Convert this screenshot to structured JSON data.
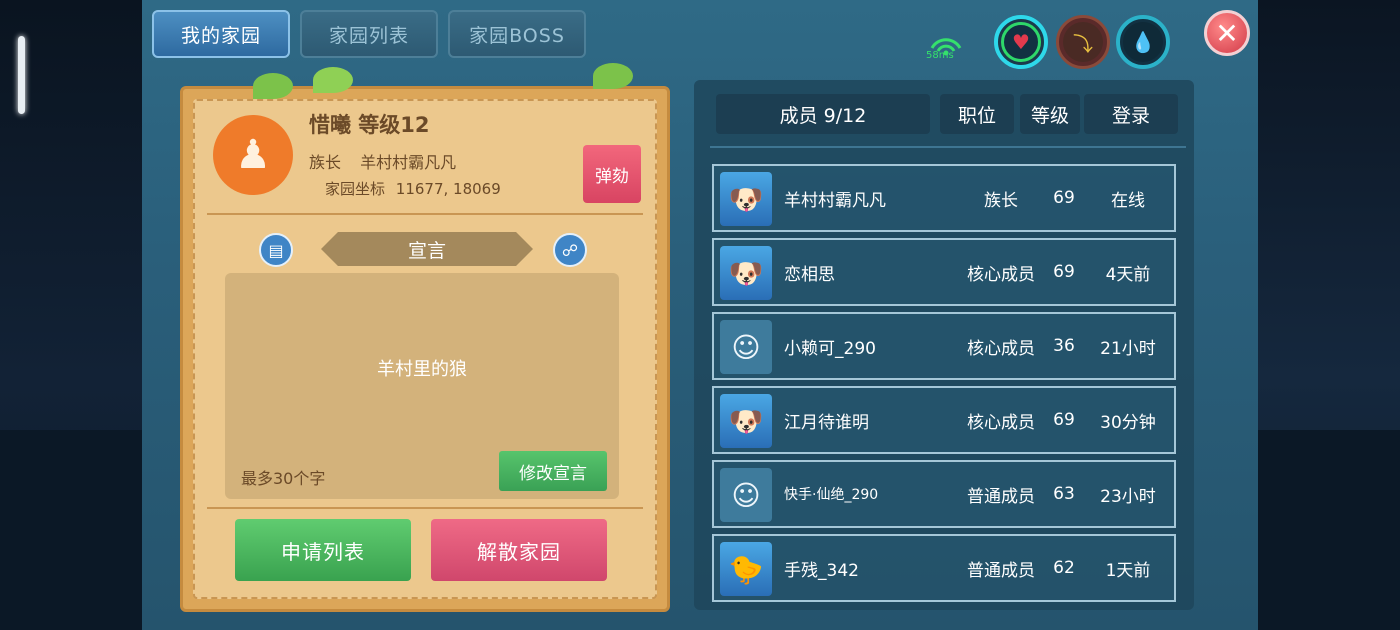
{
  "tabs": [
    {
      "label": "我的家园"
    },
    {
      "label": "家园列表"
    },
    {
      "label": "家园BOSS"
    }
  ],
  "hud": {
    "ping": "58ms",
    "heart_icon": "heart-icon",
    "item_icon": "boot-icon",
    "water_icon": "water-drop-icon",
    "colors": {
      "ping": "#35e06c",
      "health": "#e23a4d",
      "water": "#2bb2c9"
    }
  },
  "family": {
    "name_level": "惜曦 等级12",
    "leader_label": "族长",
    "leader_name": "羊村村霸凡凡",
    "coord_label": "家园坐标",
    "coord_value": "11677, 18069",
    "impeach_label": "弹劾",
    "declaration_title": "宣言",
    "declaration_text": "羊村里的狼",
    "limit_text": "最多30个字",
    "edit_label": "修改宣言",
    "apply_list_label": "申请列表",
    "dissolve_label": "解散家园"
  },
  "members": {
    "header_count": "成员 9/12",
    "header_position": "职位",
    "header_level": "等级",
    "header_login": "登录",
    "rows": [
      {
        "name": "羊村村霸凡凡",
        "role": "族长",
        "level": "69",
        "login": "在线"
      },
      {
        "name": "恋相思",
        "role": "核心成员",
        "level": "69",
        "login": "4天前"
      },
      {
        "name": "小赖可_290",
        "role": "核心成员",
        "level": "36",
        "login": "21小时"
      },
      {
        "name": "江月待谁明",
        "role": "核心成员",
        "level": "69",
        "login": "30分钟"
      },
      {
        "name": "快手·仙绝_290",
        "role": "普通成员",
        "level": "63",
        "login": "23小时"
      },
      {
        "name": "手残_342",
        "role": "普通成员",
        "level": "62",
        "login": "1天前"
      }
    ]
  }
}
